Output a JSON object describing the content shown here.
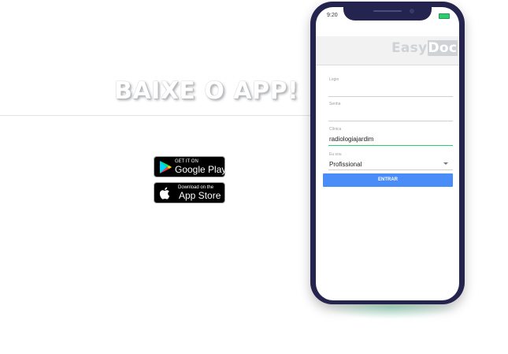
{
  "hero": {
    "headline": "BAIXE O APP!"
  },
  "stores": {
    "google_play": {
      "small": "GET IT ON",
      "big": "Google Play"
    },
    "app_store": {
      "small": "Download on the",
      "big": "App Store"
    }
  },
  "phone": {
    "status_time": "9:20",
    "battery_color": "#2ecc71",
    "app_logo": {
      "part1": "Easy",
      "part2": "Doc"
    },
    "form": {
      "login_label": "Login",
      "login_value": "",
      "password_label": "Senha",
      "password_value": "",
      "clinic_label": "Clínica",
      "clinic_value": "radiologiajardim",
      "role_label": "Eu sou",
      "role_value": "Profissional",
      "submit_label": "ENTRAR"
    }
  },
  "colors": {
    "accent": "#4a8df8",
    "active_field": "#2ecc71",
    "phone_frame": "#24244f"
  }
}
